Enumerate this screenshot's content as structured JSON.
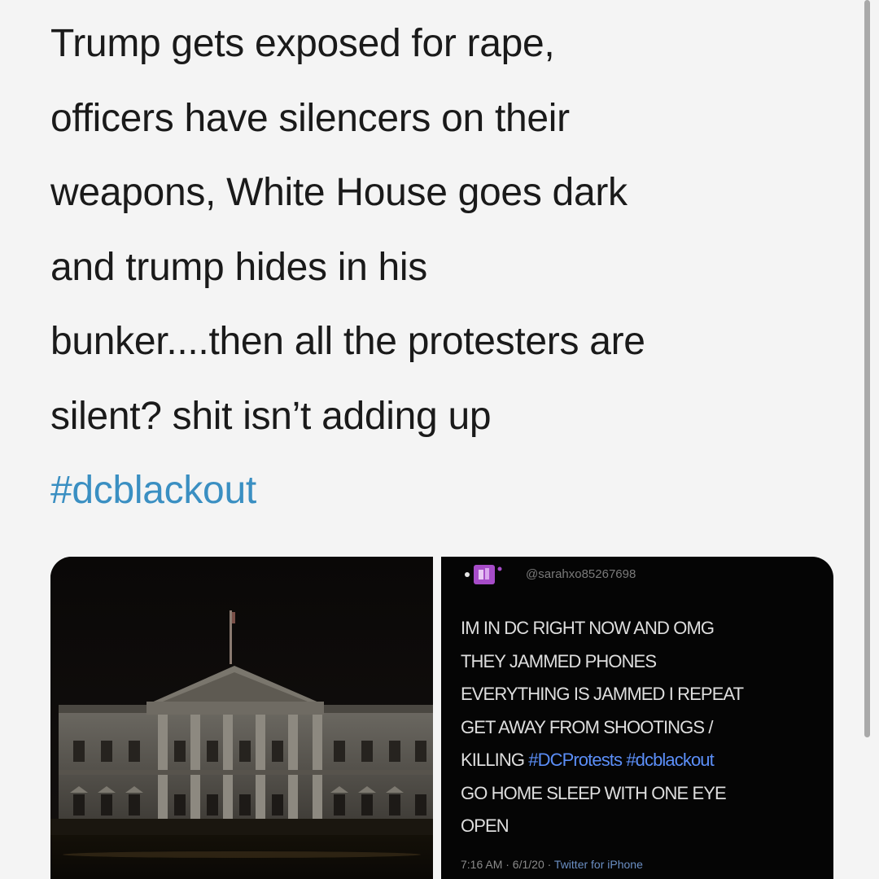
{
  "tweet": {
    "lines": [
      "Trump gets exposed for rape,",
      "officers have silencers on their",
      "weapons, White House goes dark",
      "and trump hides in his",
      "bunker....then all the protesters are",
      "silent? shit isn’t adding up"
    ],
    "hashtag": "#dcblackout",
    "hashtag_color": "#3a8fc2"
  },
  "media": {
    "photo": {
      "subject_icon": "white-house-night-photo"
    },
    "embedded_screenshot": {
      "avatar_icon": "purple-avatar-icon",
      "handle": "@sarahxo85267698",
      "lines": [
        {
          "text": "IM IN DC RIGHT NOW AND OMG",
          "tags": ""
        },
        {
          "text": "THEY JAMMED PHONES",
          "tags": ""
        },
        {
          "text": "EVERYTHING IS JAMMED I REPEAT",
          "tags": ""
        },
        {
          "text": "GET AWAY FROM SHOOTINGS /",
          "tags": ""
        },
        {
          "text": "KILLING ",
          "tags": "#DCProtests #dcblackout"
        },
        {
          "text": "GO HOME SLEEP WITH ONE EYE",
          "tags": ""
        },
        {
          "text": "OPEN",
          "tags": ""
        }
      ],
      "time": "7:16 AM · 6/1/20 · ",
      "source": "Twitter for iPhone",
      "tag_color": "#5b8ef7"
    }
  },
  "colors": {
    "background": "#f4f4f4",
    "text": "#1a1a1a",
    "screenshot_background": "#050505"
  }
}
